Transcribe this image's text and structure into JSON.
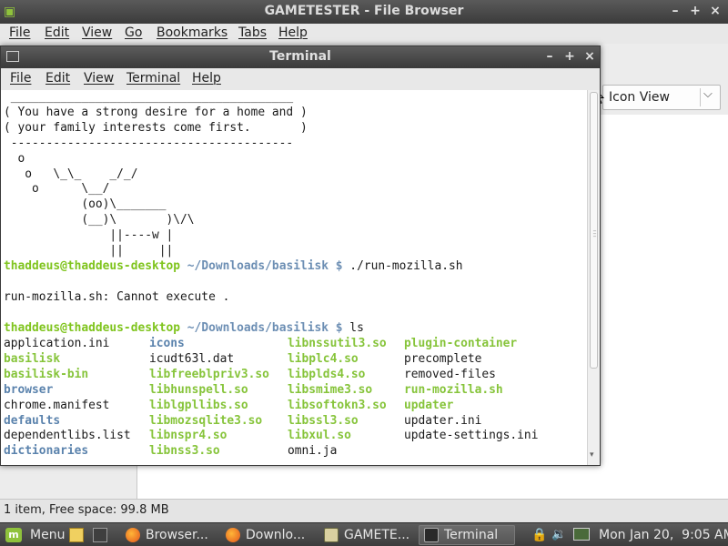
{
  "file_browser": {
    "title": "GAMETESTER - File Browser",
    "menu": [
      "File",
      "Edit",
      "View",
      "Go",
      "Bookmarks",
      "Tabs",
      "Help"
    ],
    "view_mode": "Icon View",
    "status": "1 item, Free space: 99.8 MB",
    "window_buttons": [
      "–",
      "+",
      "×"
    ]
  },
  "terminal": {
    "title": "Terminal",
    "menu": [
      "File",
      "Edit",
      "View",
      "Terminal",
      "Help"
    ],
    "window_buttons": [
      "–",
      "+",
      "×"
    ],
    "cowsay": " ________________________________________\n( You have a strong desire for a home and )\n( your family interests come first.       )\n ----------------------------------------\n  o\n   o   \\_\\_    _/_/\n    o      \\__/\n           (oo)\\_______\n           (__)\\       )\\/\\\n               ||----w |\n               ||     ||",
    "prompt_user": "thaddeus@thaddeus-desktop",
    "prompt_path": "~/Downloads/basilisk $",
    "command1": " ./run-mozilla.sh",
    "error_line": "run-mozilla.sh: Cannot execute .",
    "command2": " ls",
    "ls_columns": [
      [
        {
          "name": "application.ini",
          "type": "plain"
        },
        {
          "name": "basilisk",
          "type": "exec"
        },
        {
          "name": "basilisk-bin",
          "type": "exec"
        },
        {
          "name": "browser",
          "type": "dir"
        },
        {
          "name": "chrome.manifest",
          "type": "plain"
        },
        {
          "name": "defaults",
          "type": "dir"
        },
        {
          "name": "dependentlibs.list",
          "type": "plain"
        },
        {
          "name": "dictionaries",
          "type": "dir"
        }
      ],
      [
        {
          "name": "icons",
          "type": "dir"
        },
        {
          "name": "icudt63l.dat",
          "type": "plain"
        },
        {
          "name": "libfreeblpriv3.so",
          "type": "exec"
        },
        {
          "name": "libhunspell.so",
          "type": "exec"
        },
        {
          "name": "liblgpllibs.so",
          "type": "exec"
        },
        {
          "name": "libmozsqlite3.so",
          "type": "exec"
        },
        {
          "name": "libnspr4.so",
          "type": "exec"
        },
        {
          "name": "libnss3.so",
          "type": "exec"
        }
      ],
      [
        {
          "name": "libnssutil3.so",
          "type": "exec"
        },
        {
          "name": "libplc4.so",
          "type": "exec"
        },
        {
          "name": "libplds4.so",
          "type": "exec"
        },
        {
          "name": "libsmime3.so",
          "type": "exec"
        },
        {
          "name": "libsoftokn3.so",
          "type": "exec"
        },
        {
          "name": "libssl3.so",
          "type": "exec"
        },
        {
          "name": "libxul.so",
          "type": "exec"
        },
        {
          "name": "omni.ja",
          "type": "plain"
        }
      ],
      [
        {
          "name": "plugin-container",
          "type": "exec"
        },
        {
          "name": "precomplete",
          "type": "plain"
        },
        {
          "name": "removed-files",
          "type": "plain"
        },
        {
          "name": "run-mozilla.sh",
          "type": "exec"
        },
        {
          "name": "updater",
          "type": "exec"
        },
        {
          "name": "updater.ini",
          "type": "plain"
        },
        {
          "name": "update-settings.ini",
          "type": "plain"
        }
      ]
    ]
  },
  "taskbar": {
    "menu_label": "Menu",
    "buttons": [
      {
        "label": "Browser...",
        "icon": "firefox-icon"
      },
      {
        "label": "Downlo...",
        "icon": "firefox-icon"
      },
      {
        "label": "GAMETE...",
        "icon": "file-manager-icon"
      },
      {
        "label": "Terminal",
        "icon": "terminal-icon"
      }
    ],
    "clock": "Mon Jan 20,  9:05 AM"
  },
  "colors": {
    "prompt_user": "#7fc41d",
    "prompt_path": "#6d8fb4",
    "ls_dir": "#5b83ad",
    "ls_exec": "#86c43a",
    "mint_green": "#8fc23c"
  }
}
